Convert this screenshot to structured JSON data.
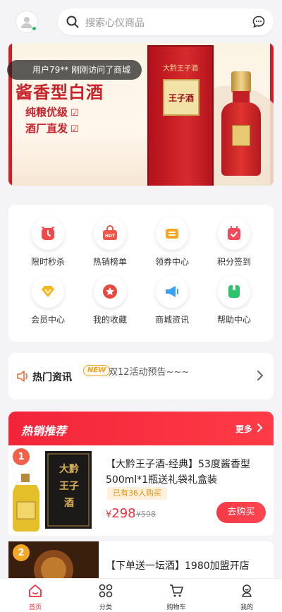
{
  "search": {
    "placeholder": "搜索心仪商品"
  },
  "banner": {
    "title": "酱香型白酒",
    "bullets": [
      "纯粮优级",
      "酒厂直发"
    ],
    "box_label": "大黔王子酒",
    "box_plate": "王子酒",
    "toast": "用户79** 刚刚访问了商城"
  },
  "menu": [
    {
      "label": "限时秒杀",
      "icon": "alarm-clock-icon",
      "color": "#f24a4a"
    },
    {
      "label": "热销榜单",
      "icon": "hot-bag-icon",
      "color": "#f2564a"
    },
    {
      "label": "领券中心",
      "icon": "coupon-icon",
      "color": "#f5a623"
    },
    {
      "label": "积分签到",
      "icon": "calendar-check-icon",
      "color": "#f24a5a"
    },
    {
      "label": "会员中心",
      "icon": "diamond-icon",
      "color": "#f5b51d"
    },
    {
      "label": "我的收藏",
      "icon": "star-icon",
      "color": "#e8483d"
    },
    {
      "label": "商城资讯",
      "icon": "megaphone-icon",
      "color": "#3ea0f2"
    },
    {
      "label": "帮助中心",
      "icon": "bookmark-icon",
      "color": "#2dc36a"
    }
  ],
  "news": {
    "title": "热门资讯",
    "badge": "NEW",
    "text": "双12活动预告~~~"
  },
  "hot": {
    "title": "热销推荐",
    "more": "更多"
  },
  "products": [
    {
      "rank": "1",
      "rank_color": "#f0604a",
      "title": "【大黔王子酒-经典】53度酱香型500ml*1瓶送礼袋礼盒装",
      "sold": "已有36人购买",
      "currency": "¥",
      "price": "298",
      "orig": "¥598",
      "buy": "去购买"
    },
    {
      "rank": "2",
      "rank_color": "#f0a828",
      "title": "【下单送一坛酒】1980加盟开店"
    }
  ],
  "tabs": [
    {
      "label": "首页",
      "icon": "home-icon",
      "active": true
    },
    {
      "label": "分类",
      "icon": "category-grid-icon",
      "active": false
    },
    {
      "label": "购物车",
      "icon": "cart-icon",
      "active": false
    },
    {
      "label": "我的",
      "icon": "user-icon",
      "active": false
    }
  ],
  "colors": {
    "accent": "#ee2d3f",
    "badge_orange": "#f0a020"
  }
}
